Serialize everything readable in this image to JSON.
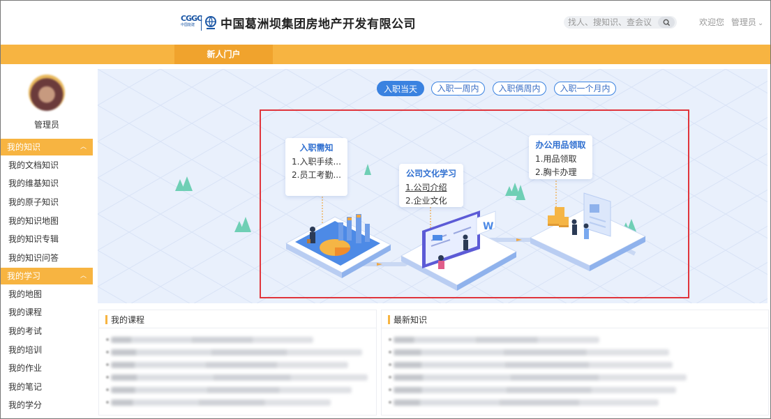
{
  "header": {
    "company_name": "中国葛洲坝集团房地产开发有限公司",
    "logo_text": "CGGC",
    "logo_sub": "中国能建",
    "search_placeholder": "找人、搜知识、查会议",
    "welcome_text": "欢迎您",
    "user_menu_label": "管理员",
    "user_menu_caret": "⌄"
  },
  "nav": {
    "active_tab": "新人门户"
  },
  "sidebar": {
    "user_name": "管理员",
    "groups": [
      {
        "title": "我的知识",
        "items": [
          "我的文档知识",
          "我的维基知识",
          "我的原子知识",
          "我的知识地图",
          "我的知识专辑",
          "我的知识问答"
        ]
      },
      {
        "title": "我的学习",
        "items": [
          "我的地图",
          "我的课程",
          "我的考试",
          "我的培训",
          "我的作业",
          "我的笔记",
          "我的学分"
        ]
      }
    ],
    "collapse_icon": "︿"
  },
  "banner": {
    "stage_tabs": [
      "入职当天",
      "入职一周内",
      "入职俩周内",
      "入职一个月内"
    ],
    "active_stage_index": 0,
    "cards": [
      {
        "title": "入职需知",
        "lines": [
          "1.入职手续...",
          "2.员工考勤..."
        ]
      },
      {
        "title": "公司文化学习",
        "lines": [
          "1.公司介绍",
          "2.企业文化"
        ]
      },
      {
        "title": "办公用品领取",
        "lines": [
          "1.用品领取",
          "2.胸卡办理"
        ]
      }
    ],
    "screen_badge": "W"
  },
  "panels": {
    "courses_title": "我的课程",
    "knowledge_title": "最新知识"
  },
  "colors": {
    "accent_orange": "#f7b441",
    "accent_orange_dark": "#f0a32d",
    "brand_blue": "#3a82e0",
    "highlight_red": "#e0343b"
  }
}
